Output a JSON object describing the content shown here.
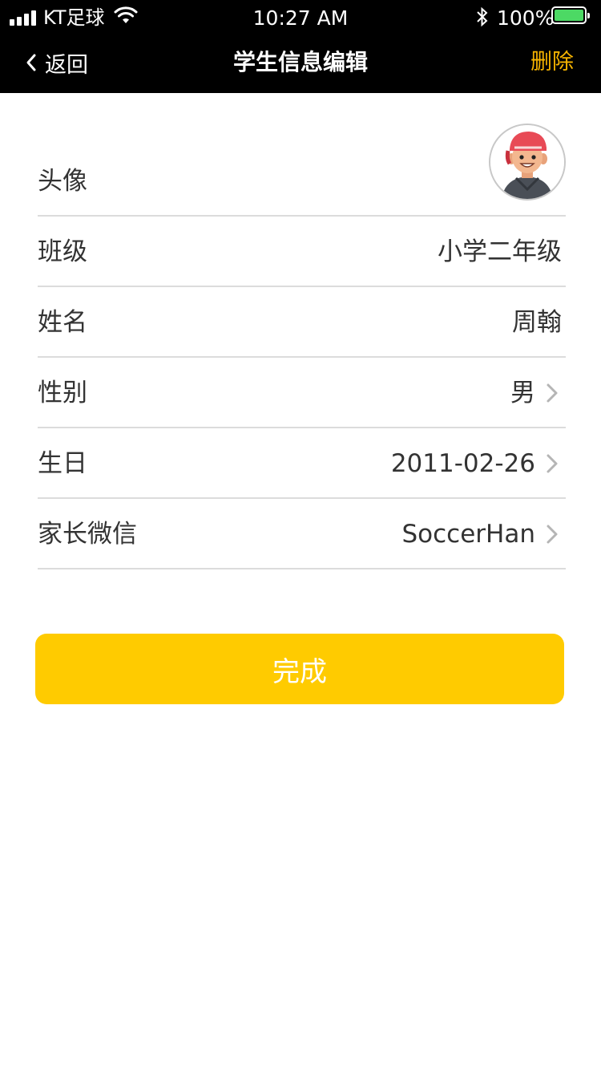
{
  "status_bar": {
    "carrier": "KT足球",
    "time": "10:27 AM",
    "battery": "100%"
  },
  "nav": {
    "back_label": "返回",
    "title": "学生信息编辑",
    "delete_label": "删除"
  },
  "form": {
    "rows": [
      {
        "label": "头像",
        "value": ""
      },
      {
        "label": "班级",
        "value": "小学二年级"
      },
      {
        "label": "姓名",
        "value": "周翰"
      },
      {
        "label": "性别",
        "value": "男"
      },
      {
        "label": "生日",
        "value": "2011-02-26"
      },
      {
        "label": "家长微信",
        "value": "SoccerHan"
      }
    ]
  },
  "done_button": {
    "label": "完成"
  },
  "colors": {
    "accent": "#ffcb00",
    "delete": "#f7b500",
    "battery": "#4cd964"
  },
  "icons": {
    "back": "chevron-left-icon",
    "row_arrow": "chevron-right-icon",
    "avatar": "cartoon-boy-avatar"
  }
}
